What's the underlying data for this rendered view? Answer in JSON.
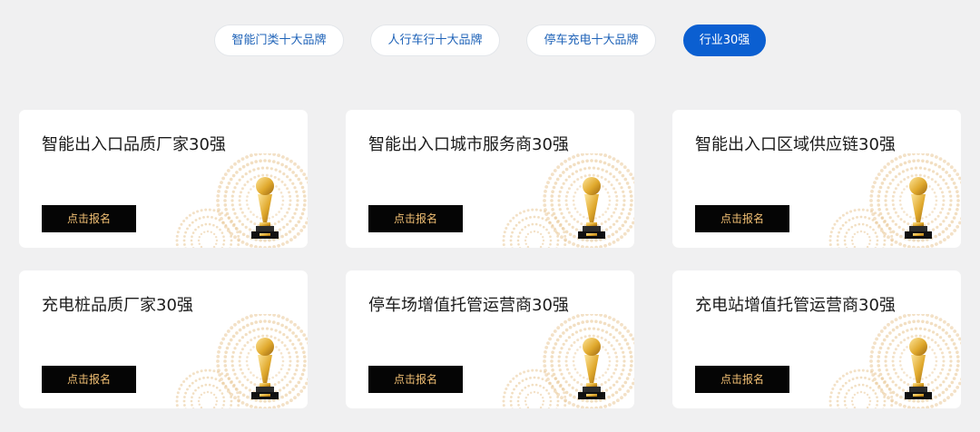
{
  "tabs": [
    {
      "label": "智能门类十大品牌",
      "active": false
    },
    {
      "label": "人行车行十大品牌",
      "active": false
    },
    {
      "label": "停车充电十大品牌",
      "active": false
    },
    {
      "label": "行业30强",
      "active": true
    }
  ],
  "cards": [
    {
      "title": "智能出入口品质厂家30强",
      "button": "点击报名"
    },
    {
      "title": "智能出入口城市服务商30强",
      "button": "点击报名"
    },
    {
      "title": "智能出入口区域供应链30强",
      "button": "点击报名"
    },
    {
      "title": "充电桩品质厂家30强",
      "button": "点击报名"
    },
    {
      "title": "停车场增值托管运营商30强",
      "button": "点击报名"
    },
    {
      "title": "充电站增值托管运营商30强",
      "button": "点击报名"
    }
  ],
  "colors": {
    "accent": "#0b5fd1",
    "button_bg": "#050505",
    "button_text": "#f2c074",
    "dots": "#e9c999"
  },
  "icons": {
    "card_decoration": "trophy-icon"
  }
}
